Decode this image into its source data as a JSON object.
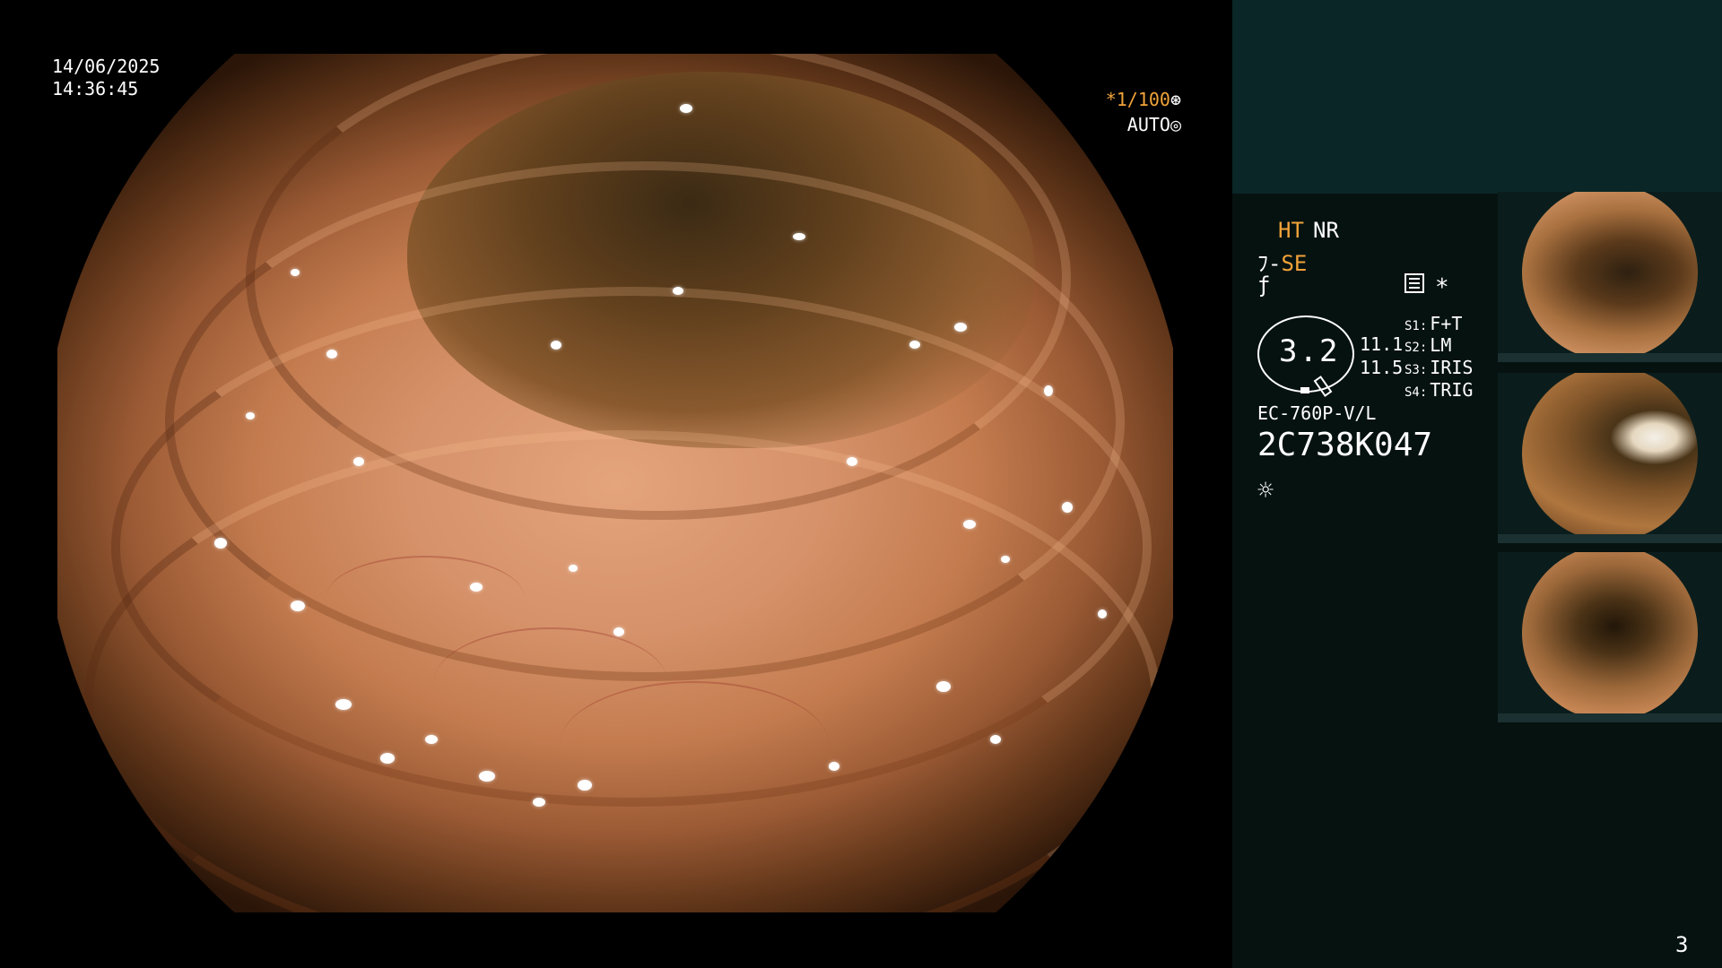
{
  "overlay": {
    "date": "14/06/2025",
    "time": "14:36:45",
    "shutter": "*1/100",
    "shutter_icon": "⊛",
    "auto": "AUTO",
    "auto_icon": "◎"
  },
  "panel": {
    "ht": "HT",
    "nr": "NR",
    "se_prefix": "ﾌ-",
    "se": "SE",
    "f_icon": "ƒ",
    "star": "*",
    "zoom_value": "3.2",
    "r1": "11.1",
    "r2": "11.5",
    "switches": [
      {
        "key": "S1:",
        "value": "F+T"
      },
      {
        "key": "S2:",
        "value": "LM"
      },
      {
        "key": "S3:",
        "value": "IRIS"
      },
      {
        "key": "S4:",
        "value": "TRIG"
      }
    ],
    "model": "EC-760P-V/L",
    "serial": "2C738K047",
    "sun_icon": "☼",
    "page_number": "3"
  },
  "colors": {
    "accent": "#f2a33a",
    "panel_bg": "#061210",
    "panel_top": "#0b2626"
  }
}
